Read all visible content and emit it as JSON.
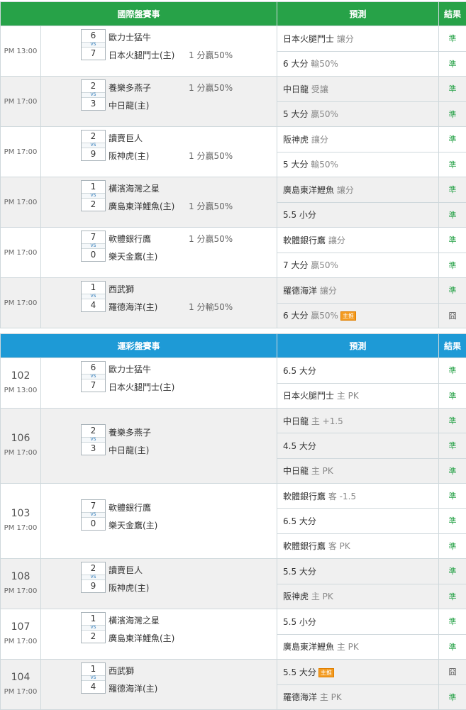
{
  "table1": {
    "header": {
      "event": "國際盤賽事",
      "prediction": "預測",
      "result": "結果"
    },
    "matches": [
      {
        "time": "PM 13:00",
        "score_a": "6",
        "score_b": "7",
        "team_a": "歐力士猛牛",
        "team_b": "日本火腿鬥士(主)",
        "odds_a": "",
        "odds_b": "1 分贏50%",
        "rows": [
          {
            "main": "日本火腿鬥士",
            "sub": " 讓分",
            "result": "準",
            "tag": ""
          },
          {
            "main": "6 大分",
            "sub": " 輸50%",
            "result": "準",
            "tag": ""
          }
        ]
      },
      {
        "time": "PM 17:00",
        "score_a": "2",
        "score_b": "3",
        "team_a": "養樂多燕子",
        "team_b": "中日龍(主)",
        "odds_a": "1 分贏50%",
        "odds_b": "",
        "rows": [
          {
            "main": "中日龍",
            "sub": " 受讓",
            "result": "準",
            "tag": ""
          },
          {
            "main": "5 大分",
            "sub": " 贏50%",
            "result": "準",
            "tag": ""
          }
        ]
      },
      {
        "time": "PM 17:00",
        "score_a": "2",
        "score_b": "9",
        "team_a": "讀賣巨人",
        "team_b": "阪神虎(主)",
        "odds_a": "",
        "odds_b": "1 分贏50%",
        "rows": [
          {
            "main": "阪神虎",
            "sub": " 讓分",
            "result": "準",
            "tag": ""
          },
          {
            "main": "5 大分",
            "sub": " 輸50%",
            "result": "準",
            "tag": ""
          }
        ]
      },
      {
        "time": "PM 17:00",
        "score_a": "1",
        "score_b": "2",
        "team_a": "橫濱海灣之星",
        "team_b": "廣島東洋鯉魚(主)",
        "odds_a": "",
        "odds_b": "1 分贏50%",
        "rows": [
          {
            "main": "廣島東洋鯉魚",
            "sub": " 讓分",
            "result": "準",
            "tag": ""
          },
          {
            "main": "5.5 小分",
            "sub": "",
            "result": "準",
            "tag": ""
          }
        ]
      },
      {
        "time": "PM 17:00",
        "score_a": "7",
        "score_b": "0",
        "team_a": "軟體銀行鷹",
        "team_b": "樂天金鷹(主)",
        "odds_a": "1 分贏50%",
        "odds_b": "",
        "rows": [
          {
            "main": "軟體銀行鷹",
            "sub": " 讓分",
            "result": "準",
            "tag": ""
          },
          {
            "main": "7 大分",
            "sub": " 贏50%",
            "result": "準",
            "tag": ""
          }
        ]
      },
      {
        "time": "PM 17:00",
        "score_a": "1",
        "score_b": "4",
        "team_a": "西武獅",
        "team_b": "羅德海洋(主)",
        "odds_a": "",
        "odds_b": "1 分輸50%",
        "rows": [
          {
            "main": "羅德海洋",
            "sub": " 讓分",
            "result": "準",
            "tag": ""
          },
          {
            "main": "6 大分",
            "sub": " 贏50%",
            "result": "囧",
            "tag": "主推"
          }
        ]
      }
    ]
  },
  "table2": {
    "header": {
      "event": "運彩盤賽事",
      "prediction": "預測",
      "result": "結果"
    },
    "matches": [
      {
        "num": "102",
        "time": "PM 13:00",
        "score_a": "6",
        "score_b": "7",
        "team_a": "歐力士猛牛",
        "team_b": "日本火腿鬥士(主)",
        "rows": [
          {
            "main": "6.5 大分",
            "sub": "",
            "result": "準",
            "tag": ""
          },
          {
            "main": "日本火腿鬥士",
            "sub": " 主 PK",
            "result": "準",
            "tag": ""
          }
        ]
      },
      {
        "num": "106",
        "time": "PM 17:00",
        "score_a": "2",
        "score_b": "3",
        "team_a": "養樂多燕子",
        "team_b": "中日龍(主)",
        "rows": [
          {
            "main": "中日龍",
            "sub": " 主 +1.5",
            "result": "準",
            "tag": ""
          },
          {
            "main": "4.5 大分",
            "sub": "",
            "result": "準",
            "tag": ""
          },
          {
            "main": "中日龍",
            "sub": " 主 PK",
            "result": "準",
            "tag": ""
          }
        ]
      },
      {
        "num": "103",
        "time": "PM 17:00",
        "score_a": "7",
        "score_b": "0",
        "team_a": "軟體銀行鷹",
        "team_b": "樂天金鷹(主)",
        "rows": [
          {
            "main": "軟體銀行鷹",
            "sub": " 客 -1.5",
            "result": "準",
            "tag": ""
          },
          {
            "main": "6.5 大分",
            "sub": "",
            "result": "準",
            "tag": ""
          },
          {
            "main": "軟體銀行鷹",
            "sub": " 客 PK",
            "result": "準",
            "tag": ""
          }
        ]
      },
      {
        "num": "108",
        "time": "PM 17:00",
        "score_a": "2",
        "score_b": "9",
        "team_a": "讀賣巨人",
        "team_b": "阪神虎(主)",
        "rows": [
          {
            "main": "5.5 大分",
            "sub": "",
            "result": "準",
            "tag": ""
          },
          {
            "main": "阪神虎",
            "sub": " 主 PK",
            "result": "準",
            "tag": ""
          }
        ]
      },
      {
        "num": "107",
        "time": "PM 17:00",
        "score_a": "1",
        "score_b": "2",
        "team_a": "橫濱海灣之星",
        "team_b": "廣島東洋鯉魚(主)",
        "rows": [
          {
            "main": "5.5 小分",
            "sub": "",
            "result": "準",
            "tag": ""
          },
          {
            "main": "廣島東洋鯉魚",
            "sub": " 主 PK",
            "result": "準",
            "tag": ""
          }
        ]
      },
      {
        "num": "104",
        "time": "PM 17:00",
        "score_a": "1",
        "score_b": "4",
        "team_a": "西武獅",
        "team_b": "羅德海洋(主)",
        "rows": [
          {
            "main": "5.5 大分",
            "sub": "",
            "result": "囧",
            "tag": "主推"
          },
          {
            "main": "羅德海洋",
            "sub": " 主 PK",
            "result": "準",
            "tag": ""
          }
        ]
      }
    ]
  }
}
